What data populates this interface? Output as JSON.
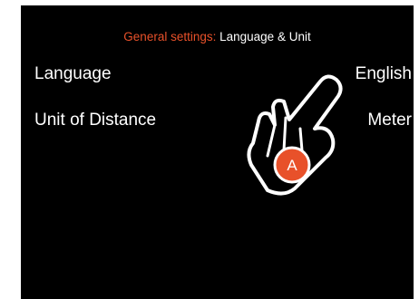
{
  "header": {
    "category": "General settings:",
    "page": "Language & Unit"
  },
  "settings": [
    {
      "label": "Language",
      "value": "English"
    },
    {
      "label": "Unit of Distance",
      "value": "Meter"
    }
  ],
  "gesture": {
    "icon": "tap-hand-icon",
    "badge": "A",
    "badge_color": "#e8512a"
  },
  "colors": {
    "background": "#000000",
    "accent": "#e8512a",
    "text": "#ffffff"
  }
}
